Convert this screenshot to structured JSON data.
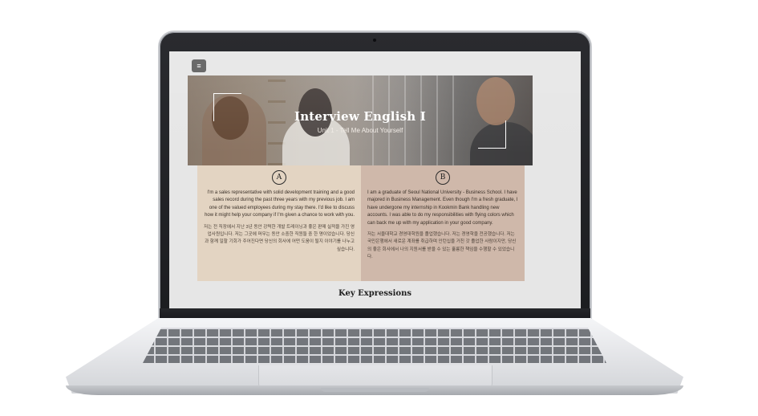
{
  "menu": {
    "icon": "hamburger-icon",
    "glyph": "≡"
  },
  "hero": {
    "title": "Interview English I",
    "subtitle": "Unit 1 - Tell Me About Yourself"
  },
  "cards": [
    {
      "badge": "A",
      "english": "I'm a sales representative with solid development training and a good sales record during the past three years with my previous job. I am one of the valued employees during my stay there. I'd like to discuss how it might help your company if I'm given a chance to work with you.",
      "korean": "저는 전 직장에서 지난 3년 동안 강력한 개발 트레이닝과 좋은 판매 실적을 가진 영업사원입니다. 저는 그곳에 머무는 동안 소중한 직원들 중 한 명이었습니다. 당신과 함께 일할 기회가 주어진다면 당신의 회사에 어떤 도움이 될지 이야기를 나누고 싶습니다."
    },
    {
      "badge": "B",
      "english": "I am a graduate of Seoul National University - Business School. I have majored in Business Management. Even though I'm a fresh graduate, I have undergone my internship in Kookmin Bank handling new accounts. I was able to do my responsibilities with flying colors which can back me up with my application in your good company.",
      "korean": "저는 서울대학교 경영대학원을 졸업했습니다. 저는 경영학을 전공했습니다. 저는 국민은행에서 새로운 계좌를 취급하며 인턴십을 거친 갓 졸업한 사람이지만, 당신의 좋은 회사에서 나의 지원서를 받을 수 있는 훌륭한 책임을 수행할 수 있었습니다."
    }
  ],
  "section": {
    "title": "Key Expressions"
  },
  "colors": {
    "card_a_bg": "#e3d4c2",
    "card_b_bg": "#cfb8aa",
    "screen_bg": "#e6e6e6",
    "menu_btn": "#5c5c5c"
  }
}
